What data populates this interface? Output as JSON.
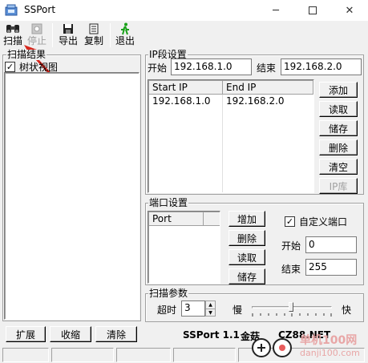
{
  "window": {
    "title": "SSPort",
    "minimize_icon": "minimize-icon",
    "maximize_icon": "maximize-icon",
    "close_icon": "close-icon"
  },
  "toolbar": {
    "scan_label": "扫描",
    "stop_label": "停止",
    "export_label": "导出",
    "copy_label": "复制",
    "exit_label": "退出"
  },
  "scan_results": {
    "title": "扫描结果",
    "tree_view_label": "树状视图",
    "tree_view_checked": true,
    "expand_label": "扩展",
    "collapse_label": "收缩",
    "clear_label": "清除"
  },
  "ip_settings": {
    "title": "IP段设置",
    "start_label": "开始",
    "start_value": "192.168.1.0",
    "end_label": "结束",
    "end_value": "192.168.2.0",
    "columns": [
      "Start IP",
      "End IP"
    ],
    "rows": [
      [
        "192.168.1.0",
        "192.168.2.0"
      ]
    ],
    "buttons": {
      "add": "添加",
      "read": "读取",
      "save": "储存",
      "delete": "删除",
      "clear": "清空",
      "ip_lib": "IP库"
    }
  },
  "port_settings": {
    "title": "端口设置",
    "column": "Port",
    "buttons": {
      "add": "增加",
      "delete": "删除",
      "read": "读取",
      "save": "储存"
    },
    "custom_label": "自定义端口",
    "custom_checked": true,
    "start_label": "开始",
    "start_value": "0",
    "end_label": "结束",
    "end_value": "255"
  },
  "scan_params": {
    "title": "扫描参数",
    "timeout_label": "超时",
    "timeout_value": "3",
    "slow_label": "慢",
    "fast_label": "快",
    "speed_level": 0.5
  },
  "footer": {
    "version": "SSPort 1.1",
    "author_prefix": "金菇",
    "site": "CZ88.NET"
  },
  "watermark": {
    "brand": "单机100网",
    "url": "danji100.com"
  },
  "colors": {
    "arrow": "#d7281e",
    "tree_check": "#000000"
  }
}
